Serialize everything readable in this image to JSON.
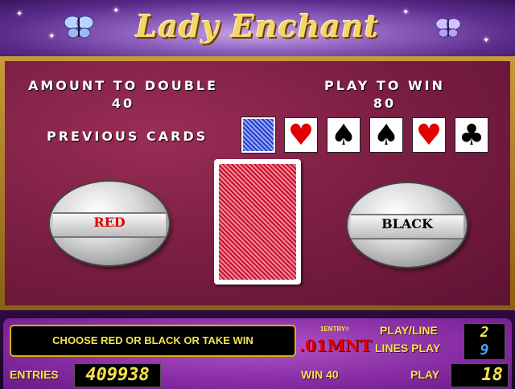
{
  "header": {
    "title": "Lady Enchant"
  },
  "gamble": {
    "amount_label": "AMOUNT TO DOUBLE",
    "amount_value": "40",
    "play_label": "PLAY TO WIN",
    "play_value": "80",
    "previous_label": "PREVIOUS CARDS",
    "previous_cards": [
      {
        "kind": "back",
        "symbol": "",
        "color": "#2340c8"
      },
      {
        "kind": "heart",
        "symbol": "♥",
        "color": "#e00000"
      },
      {
        "kind": "spade",
        "symbol": "♠",
        "color": "#000000"
      },
      {
        "kind": "spade",
        "symbol": "♠",
        "color": "#000000"
      },
      {
        "kind": "heart",
        "symbol": "♥",
        "color": "#e00000"
      },
      {
        "kind": "club",
        "symbol": "♣",
        "color": "#000000"
      }
    ],
    "red_label": "RED",
    "black_label": "BLACK"
  },
  "panel": {
    "message": "CHOOSE RED OR BLACK OR TAKE WIN",
    "entries_label": "ENTRIES",
    "entries_value": "409938",
    "entry_note": "1ENTRY=",
    "denomination": ".01MNT",
    "win_label": "WIN",
    "win_value": "40",
    "play_line_label": "PLAY/LINE",
    "play_line_value": "2",
    "lines_play_label": "LINES PLAY",
    "lines_play_value": "9",
    "play_label": "PLAY",
    "play_value": "18"
  },
  "colors": {
    "felt": "#7d1f45",
    "gold": "#f7e34a",
    "red_label": "#e00000",
    "panel": "#8a2ea6"
  }
}
